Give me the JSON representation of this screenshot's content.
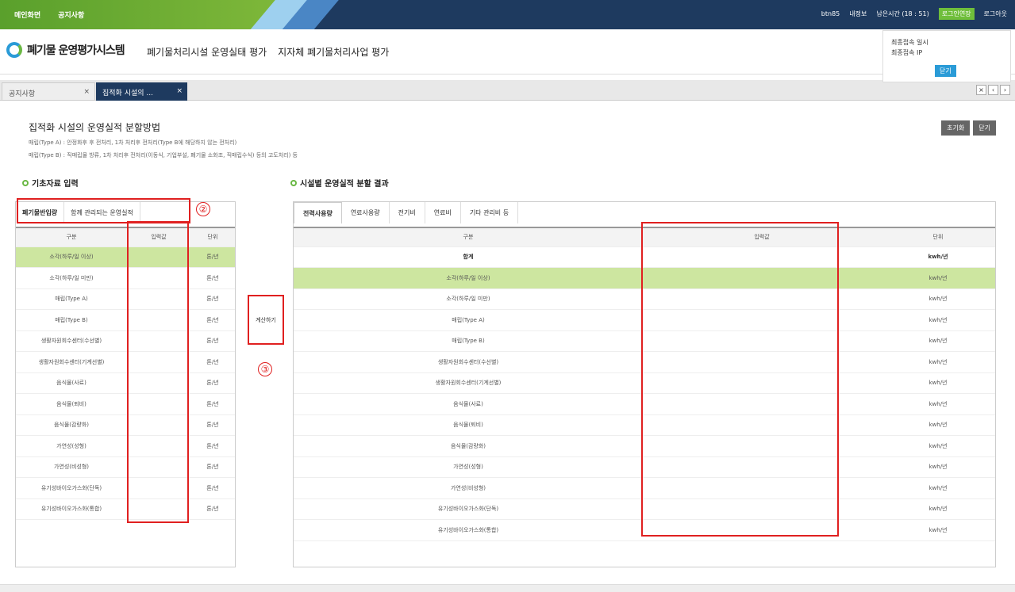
{
  "topbar": {
    "links": [
      "메인화면",
      "공지사항"
    ],
    "util": [
      "btn85",
      "내정보",
      "남은시간 (18 : 51)",
      "로그인연장",
      "로그아웃"
    ]
  },
  "header": {
    "logo_text": "폐기물 운영평가시스템",
    "nav": [
      "폐기물처리시설 운영실태 평가",
      "지자체 폐기물처리사업 평가"
    ],
    "login_info": {
      "line1": "최종접속 일시",
      "line2": "최종접속 IP",
      "close": "닫기"
    }
  },
  "tabs": [
    {
      "label": "공지사항",
      "close": "×"
    },
    {
      "label": "집적화 시설의 ...",
      "close": "×"
    }
  ],
  "tab_controls": [
    "×",
    "‹",
    "›"
  ],
  "page": {
    "title": "집적화 시설의 운영실적 분할방법",
    "desc1": "매립(Type A) : 안정화후 후 전처리, 1차 처리후 전처리(Type B에 해당하지 않는 전처리)",
    "desc2": "매립(Type B) : 직매립물 방류, 1차 처리후 전처리(이동식, 기업부설, 폐기물 소화조, 직매립수식) 등의 고도처리) 등",
    "buttons": [
      "초기화",
      "닫기"
    ]
  },
  "left": {
    "section_title": "기초자료 입력",
    "subtabs": [
      "폐기물반입량",
      "함께 관리되는 운영실적"
    ],
    "columns": [
      "구분",
      "입력값",
      "단위"
    ],
    "rows": [
      {
        "name": "소각(하루/일 이상)",
        "value": "",
        "unit": "톤/년"
      },
      {
        "name": "소각(하루/일 미만)",
        "value": "",
        "unit": "톤/년"
      },
      {
        "name": "매립(Type A)",
        "value": "",
        "unit": "톤/년"
      },
      {
        "name": "매립(Type B)",
        "value": "",
        "unit": "톤/년"
      },
      {
        "name": "생활자원회수센터(수선별)",
        "value": "",
        "unit": "톤/년"
      },
      {
        "name": "생활자원회수센터(기계선별)",
        "value": "",
        "unit": "톤/년"
      },
      {
        "name": "음식물(사료)",
        "value": "",
        "unit": "톤/년"
      },
      {
        "name": "음식물(퇴비)",
        "value": "",
        "unit": "톤/년"
      },
      {
        "name": "음식물(감량화)",
        "value": "",
        "unit": "톤/년"
      },
      {
        "name": "가연성(성형)",
        "value": "",
        "unit": "톤/년"
      },
      {
        "name": "가연성(비성형)",
        "value": "",
        "unit": "톤/년"
      },
      {
        "name": "유기성바이오가스화(단독)",
        "value": "",
        "unit": "톤/년"
      },
      {
        "name": "유기성바이오가스화(통합)",
        "value": "",
        "unit": "톤/년"
      }
    ]
  },
  "calc_button": "계산하기",
  "right": {
    "section_title": "시설별 운영실적 분할 결과",
    "subtabs": [
      "전력사용량",
      "연료사용량",
      "전기비",
      "연료비",
      "기타 관리비 등"
    ],
    "columns": [
      "구분",
      "입력값",
      "단위"
    ],
    "sum_row": {
      "name": "합계",
      "value": "",
      "unit": "kwh/년"
    },
    "rows": [
      {
        "name": "소각(하루/일 이상)",
        "value": "",
        "unit": "kwh/년"
      },
      {
        "name": "소각(하루/일 미만)",
        "value": "",
        "unit": "kwh/년"
      },
      {
        "name": "매립(Type A)",
        "value": "",
        "unit": "kwh/년"
      },
      {
        "name": "매립(Type B)",
        "value": "",
        "unit": "kwh/년"
      },
      {
        "name": "생활자원회수센터(수선별)",
        "value": "",
        "unit": "kwh/년"
      },
      {
        "name": "생활자원회수센터(기계선별)",
        "value": "",
        "unit": "kwh/년"
      },
      {
        "name": "음식물(사료)",
        "value": "",
        "unit": "kwh/년"
      },
      {
        "name": "음식물(퇴비)",
        "value": "",
        "unit": "kwh/년"
      },
      {
        "name": "음식물(감량화)",
        "value": "",
        "unit": "kwh/년"
      },
      {
        "name": "가연성(성형)",
        "value": "",
        "unit": "kwh/년"
      },
      {
        "name": "가연성(비성형)",
        "value": "",
        "unit": "kwh/년"
      },
      {
        "name": "유기성바이오가스화(단독)",
        "value": "",
        "unit": "kwh/년"
      },
      {
        "name": "유기성바이오가스화(통합)",
        "value": "",
        "unit": "kwh/년"
      }
    ]
  },
  "annotations": [
    "②",
    "③"
  ],
  "colors": {
    "brand_navy": "#1e3a5f",
    "brand_green": "#6ab844",
    "highlight_row": "#cde6a0",
    "annotation_red": "#e02020"
  }
}
